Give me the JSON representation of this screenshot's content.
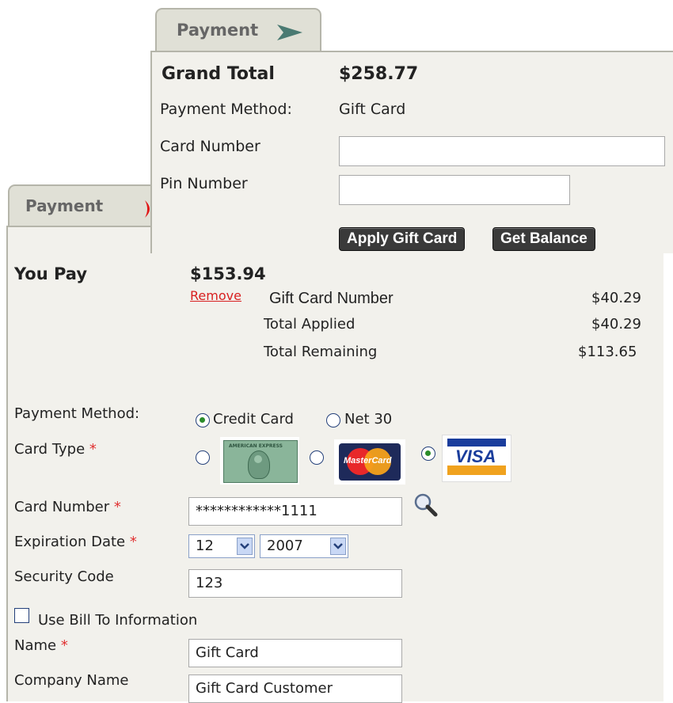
{
  "back_panel": {
    "tab_label": "Payment",
    "you_pay_label": "You Pay",
    "you_pay_amount": "$153.94",
    "remove_link": "Remove",
    "gift_card_number_label": "Gift Card Number",
    "gift_card_number_amount": "$40.29",
    "total_applied_label": "Total Applied",
    "total_applied_amount": "$40.29",
    "total_remaining_label": "Total Remaining",
    "total_remaining_amount": "$113.65",
    "payment_method_label": "Payment Method:",
    "payment_options": [
      {
        "label": "Credit Card",
        "selected": true
      },
      {
        "label": "Net 30",
        "selected": false
      }
    ],
    "card_type_label": "Card Type",
    "card_types": [
      {
        "name": "American Express",
        "selected": false
      },
      {
        "name": "MasterCard",
        "selected": false
      },
      {
        "name": "VISA",
        "selected": true
      }
    ],
    "mastercard_text": "MasterCard",
    "visa_text": "VISA",
    "amex_text": "AMERICAN EXPRESS",
    "required_mark": "*",
    "card_number_label": "Card Number",
    "card_number_value": "************1111",
    "expiration_label": "Expiration Date",
    "exp_month": "12",
    "exp_year": "2007",
    "security_code_label": "Security Code",
    "security_code_value": "123",
    "use_bill_to_label": "Use Bill To Information",
    "use_bill_to_checked": false,
    "name_label": "Name",
    "name_value": "Gift Card",
    "company_label": "Company Name",
    "company_value": "Gift Card Customer"
  },
  "front_panel": {
    "tab_label": "Payment",
    "grand_total_label": "Grand Total",
    "grand_total_amount": "$258.77",
    "payment_method_label": "Payment Method:",
    "payment_method_value": "Gift Card",
    "card_number_label": "Card Number",
    "card_number_value": "",
    "pin_number_label": "Pin Number",
    "pin_number_value": "",
    "apply_button": "Apply Gift Card",
    "balance_button": "Get Balance"
  },
  "colors": {
    "panel_bg": "#f2f1ec",
    "tab_bg": "#e0e0d6",
    "button_bg": "#3a3a3a",
    "required": "#e03030",
    "remove_link": "#d82020",
    "tab_arrow_front": "#4a7a72",
    "tab_arrow_back": "#e01818"
  }
}
